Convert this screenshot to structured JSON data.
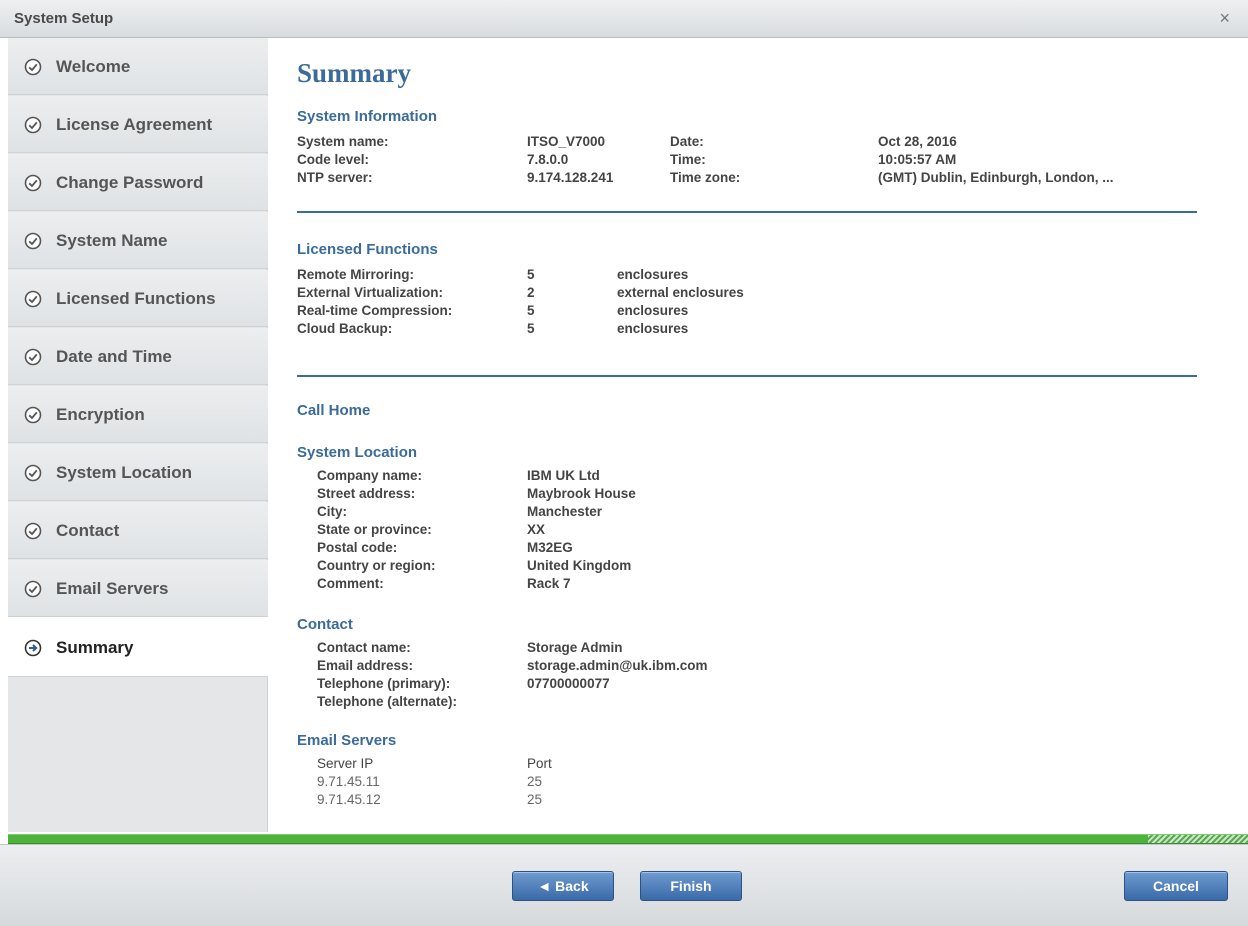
{
  "window": {
    "title": "System Setup",
    "close_glyph": "×"
  },
  "steps": [
    {
      "label": "Welcome",
      "icon": "check-circle-icon"
    },
    {
      "label": "License Agreement",
      "icon": "check-circle-icon"
    },
    {
      "label": "Change Password",
      "icon": "check-circle-icon"
    },
    {
      "label": "System Name",
      "icon": "check-circle-icon"
    },
    {
      "label": "Licensed Functions",
      "icon": "check-circle-icon"
    },
    {
      "label": "Date and Time",
      "icon": "check-circle-icon"
    },
    {
      "label": "Encryption",
      "icon": "check-circle-icon"
    },
    {
      "label": "System Location",
      "icon": "check-circle-icon"
    },
    {
      "label": "Contact",
      "icon": "check-circle-icon"
    },
    {
      "label": "Email Servers",
      "icon": "check-circle-icon"
    }
  ],
  "current_step": {
    "label": "Summary",
    "icon": "arrow-circle-icon"
  },
  "summary": {
    "heading": "Summary",
    "system_information": {
      "title": "System Information",
      "system_name_label": "System name:",
      "system_name": "ITSO_V7000",
      "code_level_label": "Code level:",
      "code_level": "7.8.0.0",
      "ntp_label": "NTP server:",
      "ntp": "9.174.128.241",
      "date_label": "Date:",
      "date": "Oct 28, 2016",
      "time_label": "Time:",
      "time": "10:05:57 AM",
      "tz_label": "Time zone:",
      "tz": "(GMT) Dublin, Edinburgh, London, ..."
    },
    "licensed_functions": {
      "title": "Licensed Functions",
      "rows": [
        {
          "label": "Remote Mirroring:",
          "value": "5",
          "unit": "enclosures"
        },
        {
          "label": "External Virtualization:",
          "value": "2",
          "unit": "external enclosures"
        },
        {
          "label": "Real-time Compression:",
          "value": "5",
          "unit": "enclosures"
        },
        {
          "label": "Cloud Backup:",
          "value": "5",
          "unit": "enclosures"
        }
      ]
    },
    "call_home": {
      "title": "Call Home"
    },
    "system_location": {
      "title": "System Location",
      "rows": [
        {
          "label": "Company name:",
          "value": "IBM UK Ltd"
        },
        {
          "label": "Street address:",
          "value": "Maybrook House"
        },
        {
          "label": "City:",
          "value": "Manchester"
        },
        {
          "label": "State or province:",
          "value": "XX"
        },
        {
          "label": "Postal code:",
          "value": "M32EG"
        },
        {
          "label": "Country or region:",
          "value": "United Kingdom"
        },
        {
          "label": "Comment:",
          "value": "Rack 7"
        }
      ]
    },
    "contact": {
      "title": "Contact",
      "rows": [
        {
          "label": "Contact name:",
          "value": "Storage Admin"
        },
        {
          "label": "Email address:",
          "value": "storage.admin@uk.ibm.com"
        },
        {
          "label": "Telephone (primary):",
          "value": "07700000077"
        },
        {
          "label": "Telephone (alternate):",
          "value": ""
        }
      ]
    },
    "email_servers": {
      "title": "Email Servers",
      "col_ip": "Server IP",
      "col_port": "Port",
      "rows": [
        {
          "ip": "9.71.45.11",
          "port": "25"
        },
        {
          "ip": "9.71.45.12",
          "port": "25"
        }
      ]
    }
  },
  "buttons": {
    "back": "◄ Back",
    "finish": "Finish",
    "cancel": "Cancel"
  },
  "colors": {
    "accent": "#3a6b9a",
    "progress": "#4fb23c",
    "button": "#3a6aa8"
  }
}
